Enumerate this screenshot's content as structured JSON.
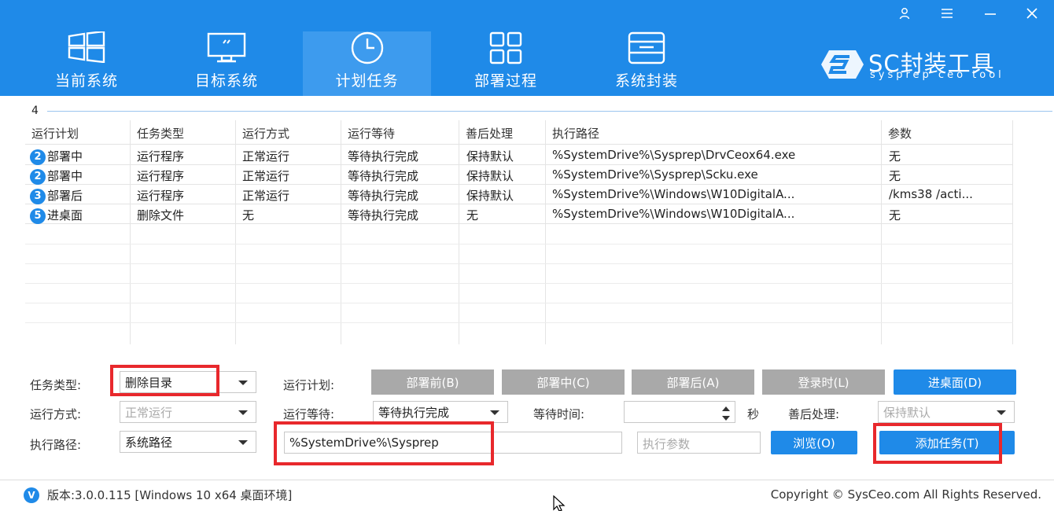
{
  "window": {
    "user_icon": "user-icon",
    "menu_icon": "menu-icon",
    "min_icon": "minimize-icon",
    "close_icon": "close-icon"
  },
  "nav": {
    "tabs": [
      {
        "label": "当前系统",
        "icon": "windows-icon"
      },
      {
        "label": "目标系统",
        "icon": "monitor-icon"
      },
      {
        "label": "计划任务",
        "icon": "clock-icon",
        "active": true
      },
      {
        "label": "部署过程",
        "icon": "grid-icon"
      },
      {
        "label": "系统封装",
        "icon": "package-icon"
      }
    ]
  },
  "brand": {
    "name": "SC封装工具",
    "subtitle": "sysprep ceo tool"
  },
  "table": {
    "count": "4",
    "columns": [
      "运行计划",
      "任务类型",
      "运行方式",
      "运行等待",
      "善后处理",
      "执行路径",
      "参数"
    ],
    "rows": [
      {
        "badge": "2",
        "plan": "部署中",
        "type": "运行程序",
        "mode": "正常运行",
        "wait": "等待执行完成",
        "after": "保持默认",
        "path": "%SystemDrive%\\Sysprep\\DrvCeox64.exe",
        "param": "无"
      },
      {
        "badge": "2",
        "plan": "部署中",
        "type": "运行程序",
        "mode": "正常运行",
        "wait": "等待执行完成",
        "after": "保持默认",
        "path": "%SystemDrive%\\Sysprep\\Scku.exe",
        "param": "无"
      },
      {
        "badge": "3",
        "plan": "部署后",
        "type": "运行程序",
        "mode": "正常运行",
        "wait": "等待执行完成",
        "after": "保持默认",
        "path": "%SystemDrive%\\Windows\\W10DigitalA...",
        "param": "/kms38 /acti..."
      },
      {
        "badge": "5",
        "plan": "进桌面",
        "type": "删除文件",
        "mode": "无",
        "wait": "等待执行完成",
        "after": "无",
        "path": "%SystemDrive%\\Windows\\W10DigitalA...",
        "param": "无"
      }
    ]
  },
  "form": {
    "task_type_label": "任务类型:",
    "task_type_value": "删除目录",
    "run_mode_label": "运行方式:",
    "run_mode_value": "正常运行",
    "exec_path_label": "执行路径:",
    "exec_path_value": "系统路径",
    "run_plan_label": "运行计划:",
    "plan_buttons": [
      "部署前(B)",
      "部署中(C)",
      "部署后(A)",
      "登录时(L)",
      "进桌面(D)"
    ],
    "run_wait_label": "运行等待:",
    "run_wait_value": "等待执行完成",
    "wait_time_label": "等待时间:",
    "wait_time_value": "",
    "seconds_label": "秒",
    "after_label": "善后处理:",
    "after_value": "保持默认",
    "path_input_value": "%SystemDrive%\\Sysprep",
    "param_placeholder": "执行参数",
    "browse_button": "浏览(O)",
    "add_task_button": "添加任务(T)"
  },
  "footer": {
    "version_badge": "V",
    "version": "版本:3.0.0.115 [Windows 10 x64 桌面环境]",
    "copyright": "Copyright © SysCeo.com All Rights Reserved."
  },
  "colors": {
    "primary": "#1f8ae8",
    "active_tab": "#3d9bee",
    "disabled_button": "#a9a9a9",
    "highlight": "#e8282c"
  }
}
